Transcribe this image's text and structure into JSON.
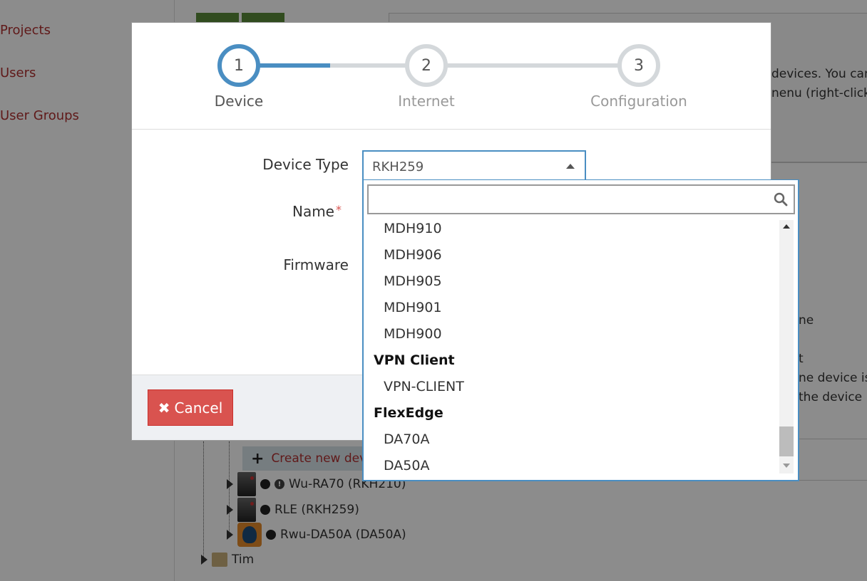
{
  "background": {
    "nav": [
      "Projects",
      "Users",
      "User Groups"
    ],
    "panel_text": [
      "devices. You can",
      "nenu (right-click)",
      "ne",
      "t",
      "ne device is",
      "the device"
    ],
    "create_label": "Create new dev",
    "tree": [
      {
        "label": "Wu-RA70 (RKH210)",
        "icon": "device-icon",
        "warning": true
      },
      {
        "label": "RLE (RKH259)",
        "icon": "device-icon",
        "warning": false
      },
      {
        "label": "Rwu-DA50A (DA50A)",
        "icon": "flexedge-icon",
        "warning": false
      },
      {
        "label": "Tim",
        "icon": "folder-icon",
        "warning": false
      }
    ]
  },
  "wizard": {
    "steps": [
      {
        "number": "1",
        "label": "Device",
        "active": true
      },
      {
        "number": "2",
        "label": "Internet",
        "active": false
      },
      {
        "number": "3",
        "label": "Configuration",
        "active": false
      }
    ],
    "fields": {
      "device_type_label": "Device Type",
      "name_label": "Name",
      "required_mark": "*",
      "firmware_label": "Firmware"
    },
    "device_type_value": "RKH259",
    "cancel_label": "Cancel"
  },
  "dropdown": {
    "search_placeholder": "",
    "items": [
      {
        "type": "option",
        "label": "MDH910"
      },
      {
        "type": "option",
        "label": "MDH906"
      },
      {
        "type": "option",
        "label": "MDH905"
      },
      {
        "type": "option",
        "label": "MDH901"
      },
      {
        "type": "option",
        "label": "MDH900"
      },
      {
        "type": "group",
        "label": "VPN Client"
      },
      {
        "type": "option",
        "label": "VPN-CLIENT"
      },
      {
        "type": "group",
        "label": "FlexEdge"
      },
      {
        "type": "option",
        "label": "DA70A"
      },
      {
        "type": "option",
        "label": "DA50A"
      }
    ]
  },
  "colors": {
    "accent": "#4a8ec2",
    "danger": "#d9534f",
    "link": "#b03030"
  }
}
